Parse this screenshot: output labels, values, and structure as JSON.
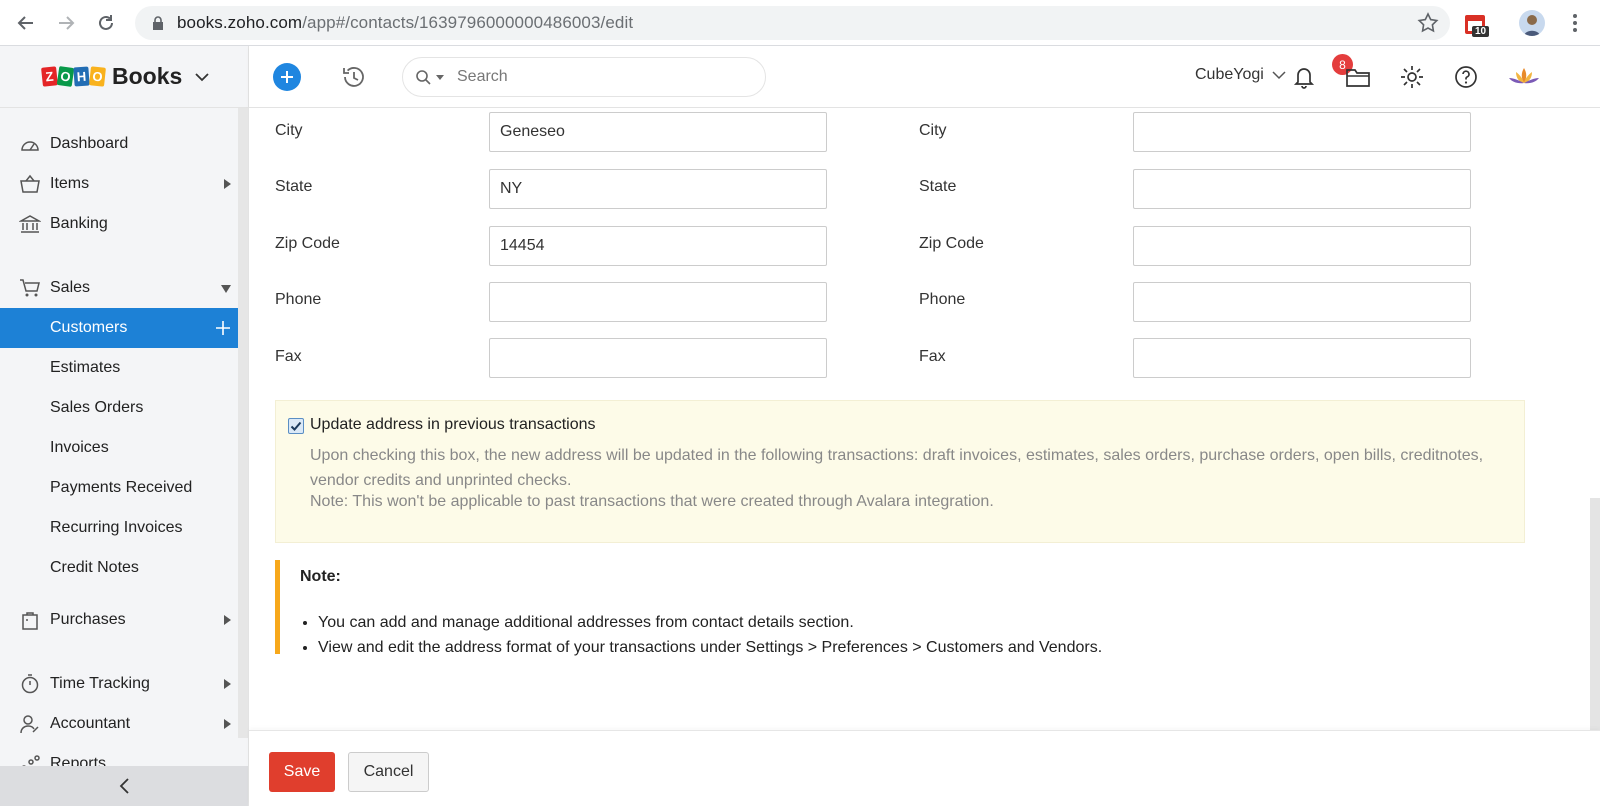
{
  "browser": {
    "url_host": "books.zoho.com",
    "url_path": "/app#/contacts/1639796000000486003/edit",
    "extension_badge": "10"
  },
  "app": {
    "logo_letters": [
      "Z",
      "O",
      "H",
      "O"
    ],
    "product_name": "Books",
    "search_placeholder": "Search",
    "org_name": "CubeYogi",
    "notification_count": "8"
  },
  "sidebar": {
    "dashboard": "Dashboard",
    "items": "Items",
    "banking": "Banking",
    "sales": "Sales",
    "customers": "Customers",
    "estimates": "Estimates",
    "sales_orders": "Sales Orders",
    "invoices": "Invoices",
    "payments_received": "Payments Received",
    "recurring_invoices": "Recurring Invoices",
    "credit_notes": "Credit Notes",
    "purchases": "Purchases",
    "time_tracking": "Time Tracking",
    "accountant": "Accountant",
    "reports": "Reports"
  },
  "billing": {
    "city_label": "City",
    "city_value": "Geneseo",
    "state_label": "State",
    "state_value": "NY",
    "zip_label": "Zip Code",
    "zip_value": "14454",
    "phone_label": "Phone",
    "phone_value": "",
    "fax_label": "Fax",
    "fax_value": ""
  },
  "shipping": {
    "city_label": "City",
    "city_value": "",
    "state_label": "State",
    "state_value": "",
    "zip_label": "Zip Code",
    "zip_value": "",
    "phone_label": "Phone",
    "phone_value": "",
    "fax_label": "Fax",
    "fax_value": ""
  },
  "update_address": {
    "label": "Update address in previous transactions",
    "checked": true,
    "description": "Upon checking this box, the new address will be updated in the following transactions: draft invoices, estimates, sales orders, purchase orders, open bills, creditnotes, vendor credits and unprinted checks.",
    "avalara_note": "Note: This won't be applicable to past transactions that were created through Avalara integration."
  },
  "note": {
    "title": "Note:",
    "items": [
      "You can add and manage additional addresses from contact details section.",
      "View and edit the address format of your transactions under Settings > Preferences > Customers and Vendors."
    ]
  },
  "actions": {
    "save": "Save",
    "cancel": "Cancel"
  },
  "colors": {
    "accent": "#1d81d6",
    "save": "#e03e2d",
    "note_border": "#f7a81b",
    "callout_bg": "#fdfbe8"
  }
}
